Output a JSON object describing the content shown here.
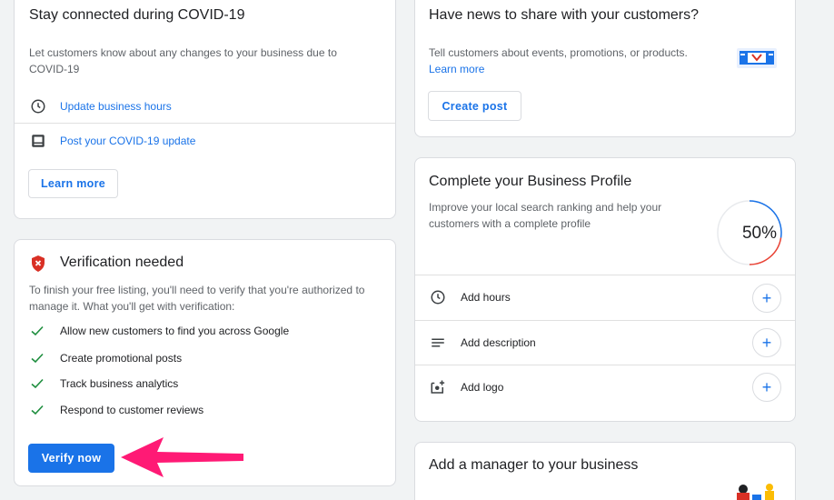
{
  "covid_card": {
    "title": "Stay connected during COVID-19",
    "description": "Let customers know about any changes to your business due to COVID-19",
    "actions": [
      {
        "label": "Update business hours",
        "icon": "clock-icon"
      },
      {
        "label": "Post your COVID-19 update",
        "icon": "post-icon"
      }
    ],
    "learn_more_button": "Learn more"
  },
  "verification_card": {
    "title": "Verification needed",
    "icon": "shield-alert-icon",
    "description": "To finish your free listing, you'll need to verify that you're authorized to manage it. What you'll get with verification:",
    "benefits": [
      "Allow new customers to find you across Google",
      "Create promotional posts",
      "Track business analytics",
      "Respond to customer reviews"
    ],
    "verify_button": "Verify now",
    "accent_color": "#1a73e8",
    "arrow_color": "#ff1a75"
  },
  "news_card": {
    "title": "Have news to share with your customers?",
    "description": "Tell customers about events, promotions, or products.",
    "learn_more_link": "Learn more",
    "create_post_button": "Create post"
  },
  "profile_card": {
    "title": "Complete your Business Profile",
    "description": "Improve your local search ranking and help your customers with a complete profile",
    "progress_label": "50%",
    "progress_value": 0.5,
    "items": [
      {
        "label": "Add hours",
        "icon": "clock-icon"
      },
      {
        "label": "Add description",
        "icon": "text-lines-icon"
      },
      {
        "label": "Add logo",
        "icon": "add-photo-icon"
      }
    ],
    "add_symbol": "+"
  },
  "manager_card": {
    "title": "Add a manager to your business"
  }
}
